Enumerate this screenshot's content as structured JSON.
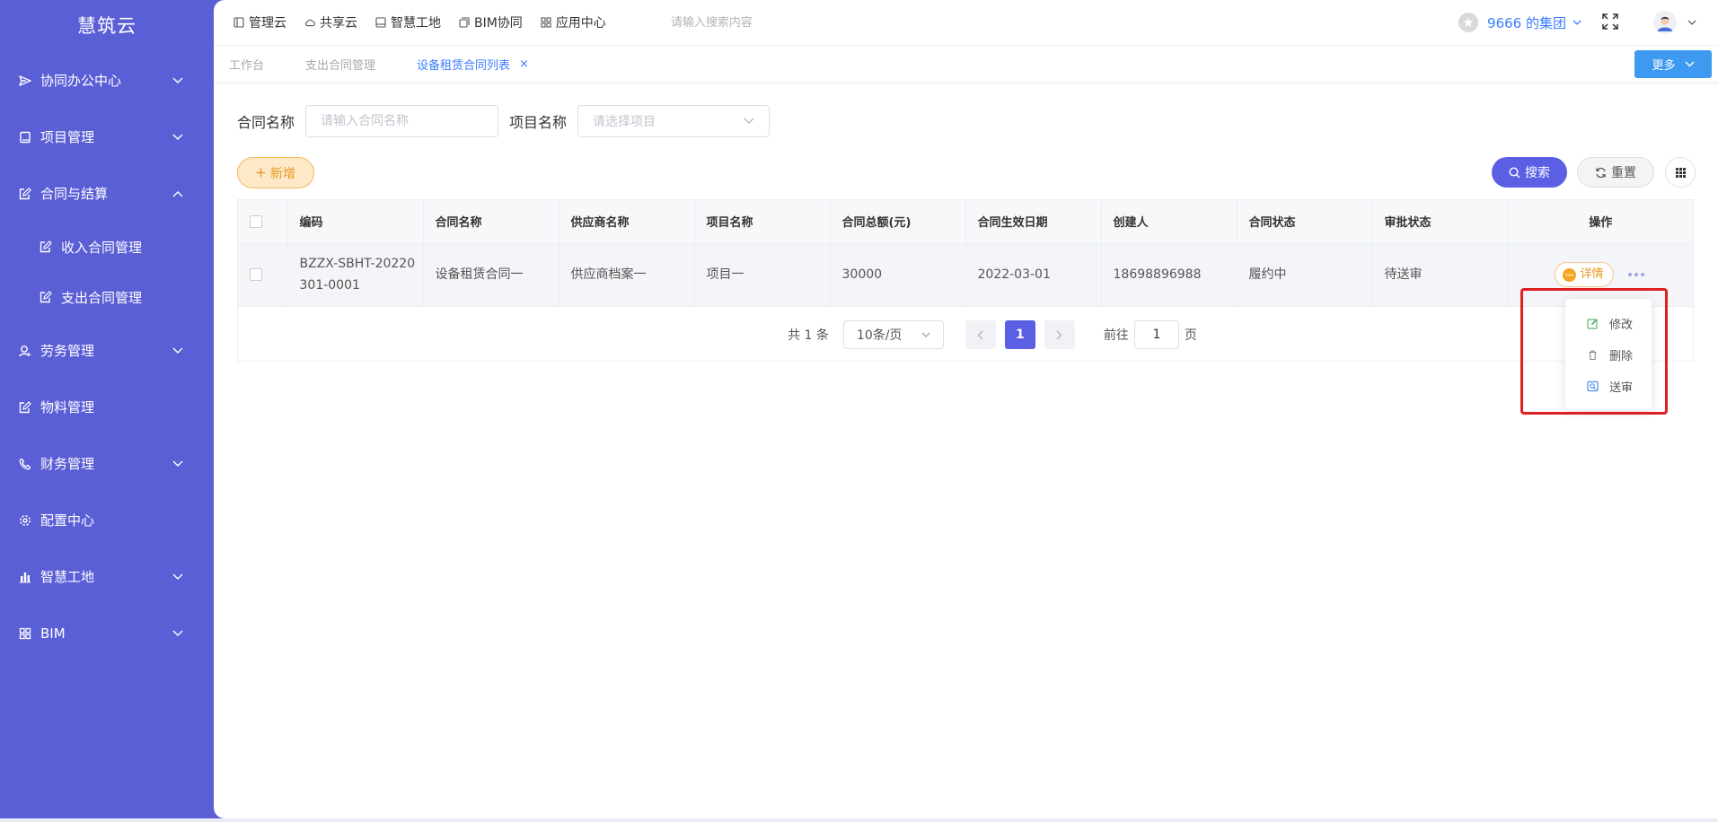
{
  "app": {
    "brand": "慧筑云"
  },
  "sidebar": {
    "items": [
      {
        "label": "协同办公中心",
        "icon": "send-icon",
        "expandable": true,
        "expanded": false
      },
      {
        "label": "项目管理",
        "icon": "book-icon",
        "expandable": true,
        "expanded": false
      },
      {
        "label": "合同与结算",
        "icon": "edit-doc-icon",
        "expandable": true,
        "expanded": true,
        "children": [
          {
            "label": "收入合同管理",
            "icon": "edit-doc-icon"
          },
          {
            "label": "支出合同管理",
            "icon": "edit-doc-icon"
          }
        ]
      },
      {
        "label": "劳务管理",
        "icon": "worker-icon",
        "expandable": true,
        "expanded": false
      },
      {
        "label": "物料管理",
        "icon": "edit-doc-icon",
        "expandable": false
      },
      {
        "label": "财务管理",
        "icon": "phone-icon",
        "expandable": true,
        "expanded": false
      },
      {
        "label": "配置中心",
        "icon": "gear-icon",
        "expandable": false
      },
      {
        "label": "智慧工地",
        "icon": "bar-chart-icon",
        "expandable": true,
        "expanded": false
      },
      {
        "label": "BIM",
        "icon": "grid-icon",
        "expandable": true,
        "expanded": false
      }
    ]
  },
  "topnav": {
    "links": [
      {
        "label": "管理云",
        "icon": "panel-icon"
      },
      {
        "label": "共享云",
        "icon": "cloud-icon"
      },
      {
        "label": "智慧工地",
        "icon": "panel-icon"
      },
      {
        "label": "BIM协同",
        "icon": "cube-icon"
      },
      {
        "label": "应用中心",
        "icon": "apps-icon"
      }
    ],
    "search_placeholder": "请输入搜索内容",
    "group_label": "9666 的集团"
  },
  "tabs": {
    "items": [
      {
        "label": "工作台",
        "active": false
      },
      {
        "label": "支出合同管理",
        "active": false
      },
      {
        "label": "设备租赁合同列表",
        "active": true,
        "closable": true
      }
    ],
    "close_glyph": "×",
    "more_label": "更多"
  },
  "filters": {
    "contract_name_label": "合同名称",
    "contract_name_placeholder": "请输入合同名称",
    "project_name_label": "项目名称",
    "project_placeholder": "请选择项目"
  },
  "actions": {
    "add_label": "新增",
    "search_label": "搜索",
    "reset_label": "重置"
  },
  "table": {
    "columns": [
      "编码",
      "合同名称",
      "供应商名称",
      "项目名称",
      "合同总额(元)",
      "合同生效日期",
      "创建人",
      "合同状态",
      "审批状态",
      "操作"
    ],
    "rows": [
      {
        "code": "BZZX-SBHT-20220301-0001",
        "contract_name": "设备租赁合同一",
        "supplier": "供应商档案一",
        "project": "项目一",
        "amount": "30000",
        "effective_date": "2022-03-01",
        "creator": "18698896988",
        "contract_status": "履约中",
        "approval_status": "待送审",
        "detail_label": "详情"
      }
    ]
  },
  "pagination": {
    "total_text": "共 1 条",
    "page_size": "10条/页",
    "current_page": "1",
    "goto_prefix": "前往",
    "goto_value": "1",
    "goto_suffix": "页"
  },
  "row_menu": {
    "items": [
      {
        "label": "修改",
        "icon": "edit-icon"
      },
      {
        "label": "删除",
        "icon": "trash-icon"
      },
      {
        "label": "送审",
        "icon": "submit-icon"
      }
    ]
  },
  "colors": {
    "sidebar_bg": "#5b5fd6",
    "primary": "#5b5fe4",
    "link_blue": "#3b7cff",
    "warning": "#e8961f",
    "highlight": "#e02020"
  }
}
